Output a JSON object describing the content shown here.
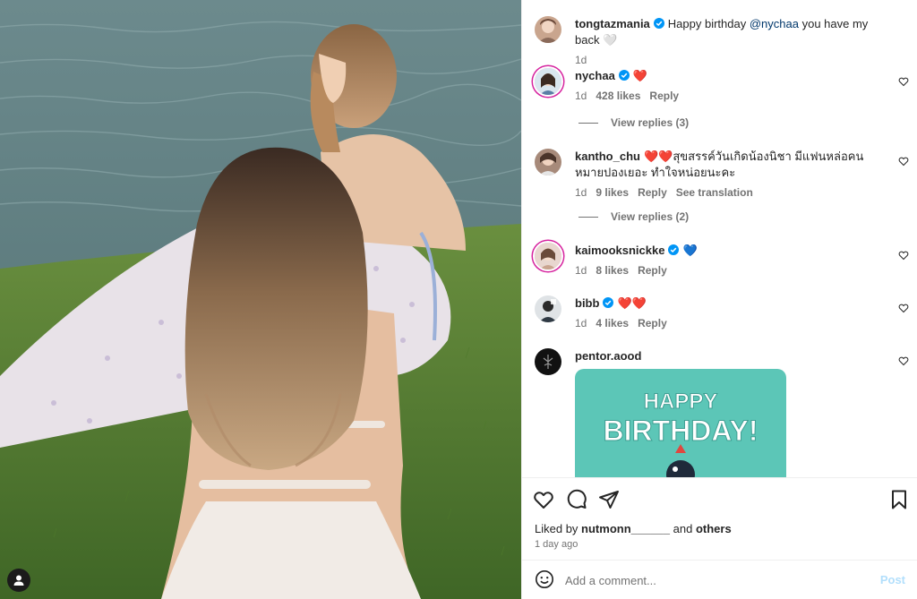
{
  "post": {
    "caption": {
      "username": "tongtazmania",
      "text_before": "Happy birthday ",
      "mention": "@nychaa",
      "text_after": " you have my back 🤍",
      "time": "1d"
    },
    "comments": [
      {
        "username": "nychaa",
        "verified": true,
        "text": "❤️",
        "time": "1d",
        "likes": "428 likes",
        "reply": "Reply",
        "view_replies": "View replies (3)"
      },
      {
        "username": "kantho_chu",
        "verified": false,
        "text": "❤️❤️สุขสรรค์วันเกิดน้องนิชา มีแฟนหล่อคนหมายปองเยอะ ทำใจหน่อยนะคะ",
        "time": "1d",
        "likes": "9 likes",
        "reply": "Reply",
        "translate": "See translation",
        "view_replies": "View replies (2)"
      },
      {
        "username": "kaimooksnickke",
        "verified": true,
        "text": "💙",
        "time": "1d",
        "likes": "8 likes",
        "reply": "Reply"
      },
      {
        "username": "bibb",
        "verified": true,
        "text": "❤️❤️",
        "time": "1d",
        "likes": "4 likes",
        "reply": "Reply"
      },
      {
        "username": "pentor.aood",
        "verified": false,
        "gif_line1": "HAPPY",
        "gif_line2": "BIRTHDAY!"
      }
    ],
    "liked_by": {
      "prefix": "Liked by ",
      "user": "nutmonn______",
      "middle": " and ",
      "others": "others"
    },
    "age": "1 day ago",
    "add_comment": {
      "placeholder": "Add a comment...",
      "post_label": "Post"
    }
  },
  "colors": {
    "verified": "#0095f6",
    "heart": "#ed4956",
    "gif_bg": "#5cc6b7",
    "post_disabled": "#b2dffc"
  },
  "icons": [
    "heart-icon",
    "comment-icon",
    "share-icon",
    "bookmark-icon",
    "emoji-icon",
    "user-tag-icon",
    "verified-icon"
  ]
}
